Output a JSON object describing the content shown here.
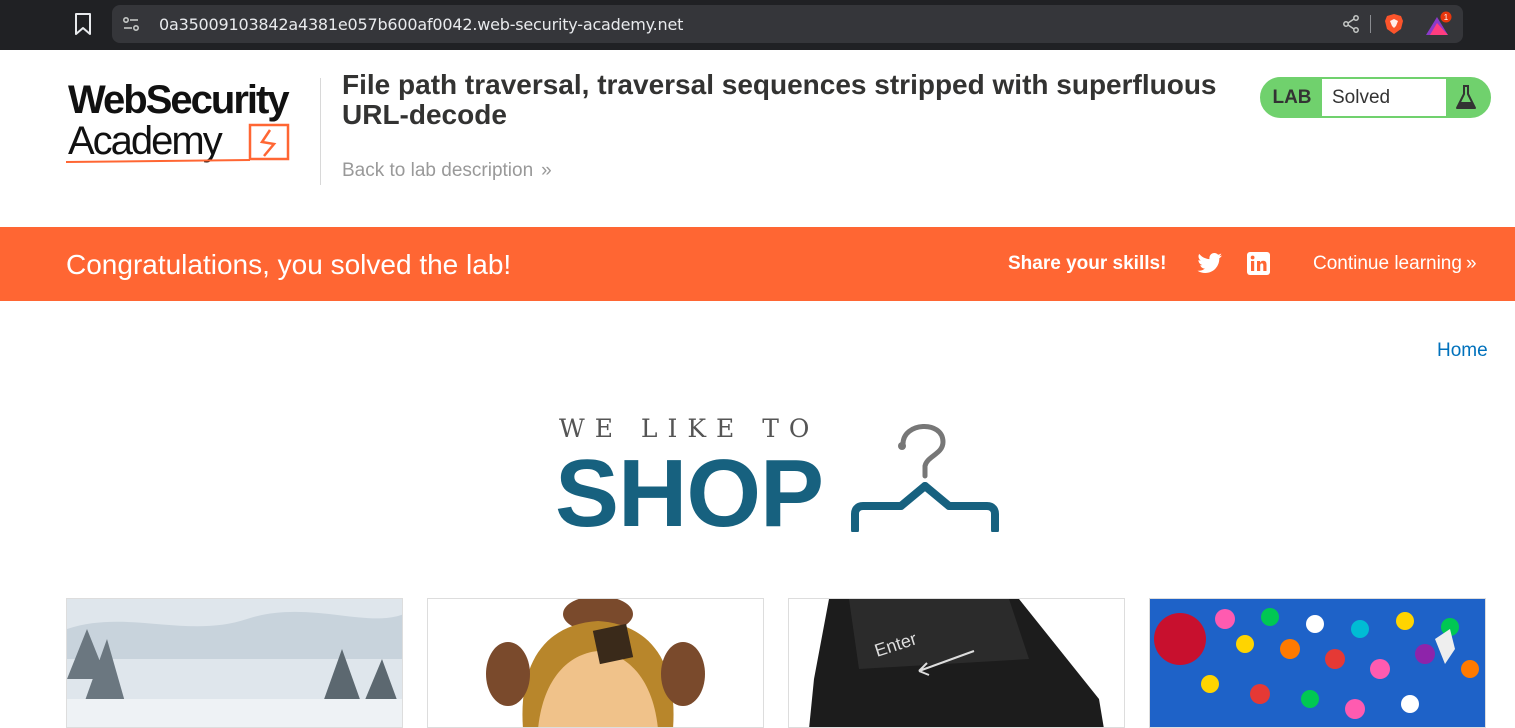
{
  "browser": {
    "url": "0a35009103842a4381e057b600af0042.web-security-academy.net",
    "icons": [
      "bookmark-icon",
      "site-info-icon",
      "share-icon",
      "brave-shield-icon",
      "brave-rewards-icon"
    ],
    "rewards_badge": "1"
  },
  "header": {
    "logo": {
      "line1": "WebSecurity",
      "line2": "Academy"
    },
    "title": "File path traversal, traversal sequences stripped with superfluous URL-decode",
    "back_link": "Back to lab description",
    "back_chevron": "»",
    "lab_badge": "LAB",
    "lab_status": "Solved"
  },
  "banner": {
    "message": "Congratulations, you solved the lab!",
    "share_label": "Share your skills!",
    "continue_label": "Continue learning",
    "continue_chevron": "»",
    "color": "#ff6633"
  },
  "nav": {
    "home": "Home"
  },
  "shop": {
    "tagline": "WE LIKE TO",
    "word": "SHOP",
    "color": "#17617f"
  },
  "products": [
    {
      "image": "snowy-landscape"
    },
    {
      "image": "poo-head-hat"
    },
    {
      "image": "enter-key-cushion"
    },
    {
      "image": "balloons"
    }
  ],
  "colors": {
    "accent": "#ff6633",
    "lab_green": "#70d16d",
    "link": "#0071bc"
  }
}
